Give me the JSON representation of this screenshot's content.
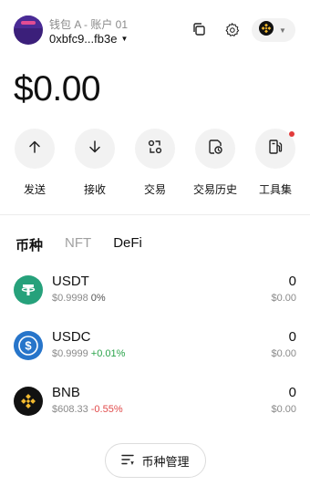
{
  "header": {
    "account_name": "钱包 A - 账户 01",
    "account_address": "0xbfc9...fb3e",
    "network": "BNB Chain"
  },
  "balance": "$0.00",
  "actions": [
    {
      "label": "发送",
      "icon": "arrow-up-icon"
    },
    {
      "label": "接收",
      "icon": "arrow-down-icon"
    },
    {
      "label": "交易",
      "icon": "swap-icon"
    },
    {
      "label": "交易历史",
      "icon": "history-icon"
    },
    {
      "label": "工具集",
      "icon": "tools-icon"
    }
  ],
  "tabs": [
    "币种",
    "NFT",
    "DeFi"
  ],
  "tokens": [
    {
      "symbol": "USDT",
      "price": "$0.9998",
      "change": "0%",
      "balance": "0",
      "value": "$0.00"
    },
    {
      "symbol": "USDC",
      "price": "$0.9999",
      "change": "+0.01%",
      "balance": "0",
      "value": "$0.00"
    },
    {
      "symbol": "BNB",
      "price": "$608.33",
      "change": "-0.55%",
      "balance": "0",
      "value": "$0.00"
    }
  ],
  "manage_label": "币种管理",
  "colors": {
    "usdt": "#26a17b",
    "usdc": "#2775ca",
    "bnb": "#f3ba2f",
    "positive": "#2aa34a",
    "negative": "#e14b4b",
    "notify_dot": "#e23a3a"
  }
}
